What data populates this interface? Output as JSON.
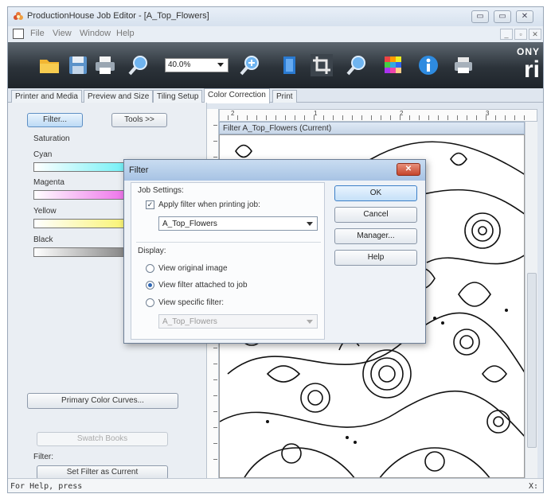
{
  "window": {
    "title": "ProductionHouse Job Editor - [A_Top_Flowers]",
    "controls": {
      "minimize": "▭",
      "maximize": "▭",
      "close": "✕"
    },
    "mdi_controls": {
      "minimize": "_",
      "restore": "▫",
      "close": "✕"
    }
  },
  "menu": [
    "File",
    "View",
    "Window",
    "Help"
  ],
  "toolbar": {
    "zoom_value": "40.0%",
    "brand_small": "ONY",
    "brand_big": "ri",
    "icons": [
      "folder-icon",
      "save-icon",
      "print-icon",
      "zoom-icon",
      "zoom-in-icon",
      "book-icon",
      "crop-icon",
      "zoom-out-icon",
      "color-grid-icon",
      "info-icon",
      "printer-icon"
    ]
  },
  "tabs": [
    "Printer and Media",
    "Preview and Size",
    "Tiling Setup",
    "Color Correction",
    "Print"
  ],
  "active_tab": "Color Correction",
  "left_panel": {
    "filter_button": "Filter...",
    "tools_button": "Tools >>",
    "saturation_label": "Saturation",
    "channels": [
      {
        "label": "Cyan",
        "color": "#00e5f0"
      },
      {
        "label": "Magenta",
        "color": "#e000d8"
      },
      {
        "label": "Yellow",
        "color": "#f5ea00"
      },
      {
        "label": "Black",
        "color": "#222222"
      }
    ],
    "primary_curves_button": "Primary Color Curves...",
    "swatch_books_button": "Swatch Books",
    "filter_label": "Filter:",
    "set_filter_button": "Set Filter as Current"
  },
  "canvas": {
    "title": "Filter A_Top_Flowers (Current)",
    "ruler_numbers": [
      "2",
      "1",
      "2",
      "3"
    ]
  },
  "dialog": {
    "title": "Filter",
    "close": "✕",
    "job_settings_label": "Job Settings:",
    "apply_filter_label": "Apply filter when printing job:",
    "apply_filter_checked": true,
    "filter_select_value": "A_Top_Flowers",
    "display_label": "Display:",
    "radio_options": [
      {
        "label": "View original image",
        "selected": false
      },
      {
        "label": "View filter attached to job",
        "selected": true
      },
      {
        "label": "View specific filter:",
        "selected": false
      }
    ],
    "specific_filter_value": "A_Top_Flowers",
    "buttons": {
      "ok": "OK",
      "cancel": "Cancel",
      "manager": "Manager...",
      "help": "Help"
    }
  },
  "status": {
    "help": "For Help, press",
    "coord": "X:"
  }
}
